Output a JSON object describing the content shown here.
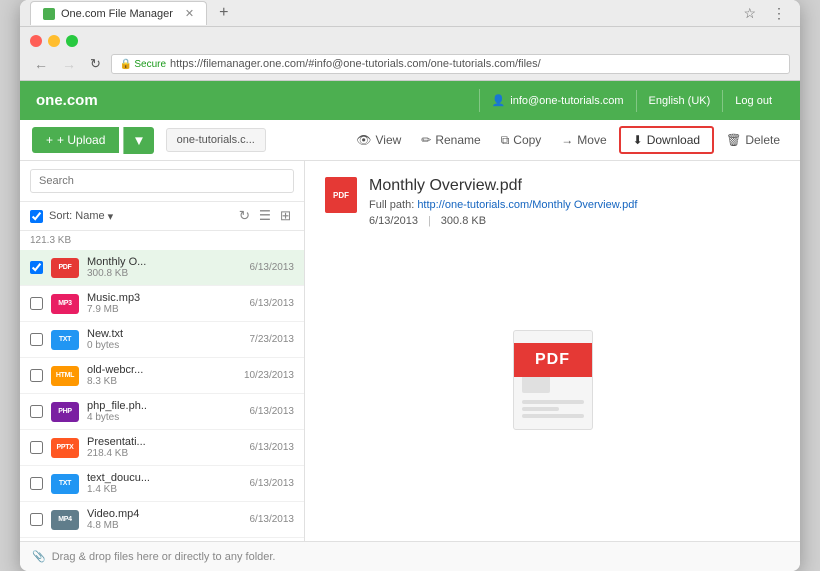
{
  "browser": {
    "tab_title": "One.com File Manager",
    "url": "https://filemanager.one.com/#info@one-tutorials.com/one-tutorials.com/files/",
    "secure_label": "Secure"
  },
  "header": {
    "logo": "one.com",
    "user": "info@one-tutorials.com",
    "lang": "English (UK)",
    "logout": "Log out"
  },
  "toolbar": {
    "upload_label": "+ Upload",
    "breadcrumb": "one-tutorials.c...",
    "view_label": "View",
    "rename_label": "Rename",
    "copy_label": "Copy",
    "move_label": "Move",
    "download_label": "Download",
    "delete_label": "Delete"
  },
  "search": {
    "placeholder": "Search"
  },
  "sort": {
    "label": "Sort: Name"
  },
  "files": [
    {
      "id": 1,
      "name": "Monthly O...",
      "size": "300.8 KB",
      "date": "6/13/2013",
      "type": "pdf",
      "selected": true
    },
    {
      "id": 2,
      "name": "Music.mp3",
      "size": "7.9 MB",
      "date": "6/13/2013",
      "type": "mp3",
      "selected": false
    },
    {
      "id": 3,
      "name": "New.txt",
      "size": "0 bytes",
      "date": "7/23/2013",
      "type": "txt",
      "selected": false
    },
    {
      "id": 4,
      "name": "old-webcr...",
      "size": "8.3 KB",
      "date": "10/23/2013",
      "type": "html",
      "selected": false
    },
    {
      "id": 5,
      "name": "php_file.ph..",
      "size": "4 bytes",
      "date": "6/13/2013",
      "type": "php",
      "selected": false
    },
    {
      "id": 6,
      "name": "Presentati...",
      "size": "218.4 KB",
      "date": "6/13/2013",
      "type": "pptx",
      "selected": false
    },
    {
      "id": 7,
      "name": "text_doucu...",
      "size": "1.4 KB",
      "date": "6/13/2013",
      "type": "txt",
      "selected": false
    },
    {
      "id": 8,
      "name": "Video.mp4",
      "size": "4.8 MB",
      "date": "6/13/2013",
      "type": "mp4",
      "selected": false
    }
  ],
  "folder_size": "121.3 KB",
  "detail": {
    "filename": "Monthly Overview.pdf",
    "full_path_label": "Full path:",
    "full_path_url": "http://one-tutorials.com/Monthly Overview.pdf",
    "date": "6/13/2013",
    "size": "300.8 KB",
    "pdf_label": "PDF"
  },
  "drop_footer": "Drag & drop files here or directly to any folder."
}
